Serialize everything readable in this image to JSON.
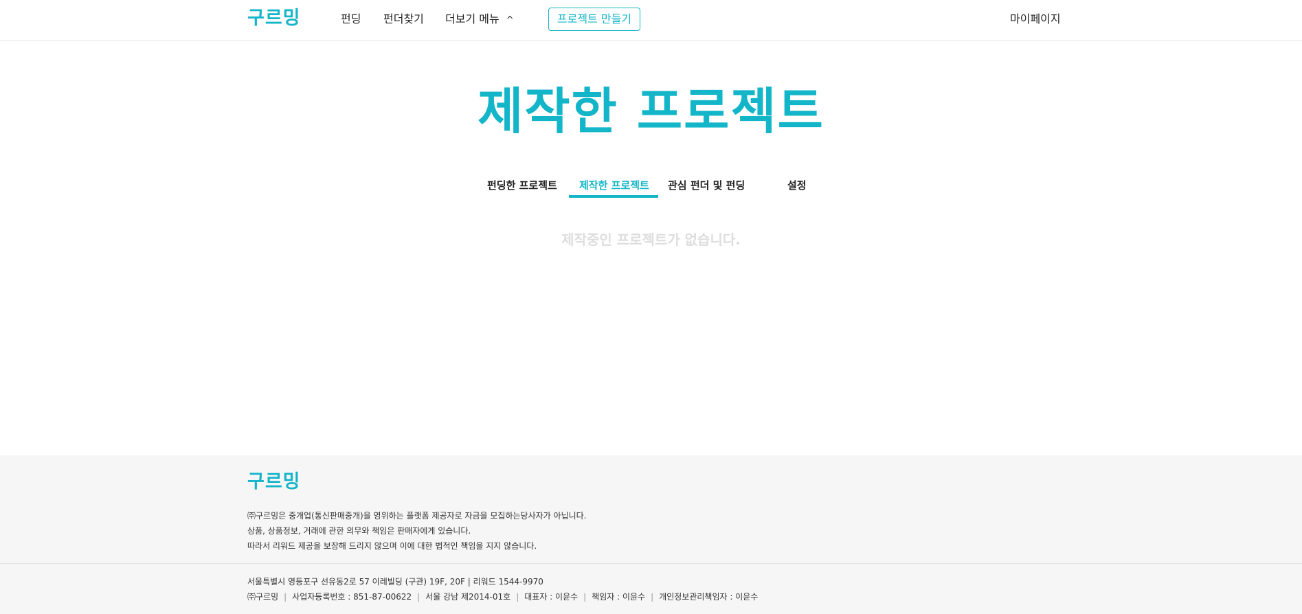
{
  "header": {
    "logo": "구르밍",
    "nav": [
      "펀딩",
      "펀더찾기",
      "더보기 메뉴"
    ],
    "more_chevron": "^",
    "create_button": "프로젝트 만들기",
    "mypage": "마이페이지"
  },
  "main": {
    "title": "제작한 프로젝트",
    "tabs": [
      "펀딩한 프로젝트",
      "제작한 프로젝트",
      "관심 펀더 및 펀딩",
      "설정"
    ],
    "active_tab": 1,
    "empty_message": "제작중인 프로젝트가 없습니다."
  },
  "footer": {
    "logo": "구르밍",
    "notice_lines": [
      "㈜구르밍은 중개업(통신판매중개)을 영위하는 플랫폼 제공자로 자금을 모집하는당사자가 아닙니다.",
      "상품, 상품정보, 거래에 관한 의무와 책임은 판매자에게 있습니다.",
      "따라서 리워드 제공을 보장해 드리지 않으며 이에 대한 법적인 책임을 지지 않습니다."
    ],
    "address": "서울특별시 영등포구 선유동2로 57 이레빌딩 (구관) 19F, 20F | 리워드 1544-9970",
    "company": "㈜구르밍",
    "business_number": "사업자등록번호 : 851-87-00622",
    "license": "서울 강남 제2014-01호",
    "ceo": "대표자 : 이윤수",
    "manager": "책임자 : 이윤수",
    "privacy_officer": "개인정보관리책임자 : 이윤수",
    "separator": "|"
  },
  "colors": {
    "accent": "#13b5c8",
    "footer_bg": "#f6f6f6",
    "empty_text": "#dddddd"
  }
}
